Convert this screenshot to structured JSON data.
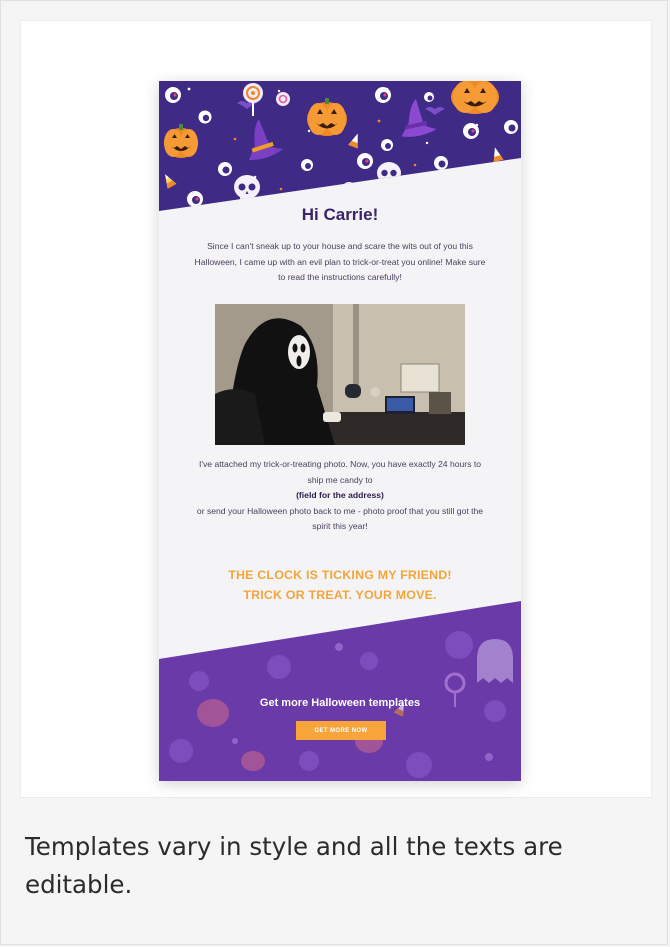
{
  "email": {
    "greeting": "Hi Carrie!",
    "intro": "Since I can't sneak up to your house and scare the wits out of you this Halloween, I came up with an evil plan to trick-or-treat you online! Make sure to read the instructions carefully!",
    "body_line1": "I've attached my trick-or-treating photo. Now, you have exactly 24 hours to ship me candy to",
    "body_field": "(field for the address)",
    "body_line2": "or send your Halloween photo back to me - photo proof that you still got the spirit this year!",
    "cta_line1": "THE CLOCK IS TICKING MY FRIEND!",
    "cta_line2": "TRICK OR TREAT. YOUR MOVE.",
    "footer_title": "Get more Halloween templates",
    "footer_button": "GET MORE NOW"
  },
  "caption": "Templates vary in style and all the texts are editable.",
  "colors": {
    "page_bg": "#f5f5f5",
    "hero_purple": "#3f2a86",
    "footer_purple": "#6a3aa8",
    "pumpkin": "#f08a24",
    "accent_orange": "#f3a53a",
    "heading_purple": "#3b2467"
  },
  "icons": [
    "pumpkin-icon",
    "skull-icon",
    "eyeball-icon",
    "witch-hat-icon",
    "candy-corn-icon",
    "lollipop-icon",
    "ghost-icon"
  ]
}
